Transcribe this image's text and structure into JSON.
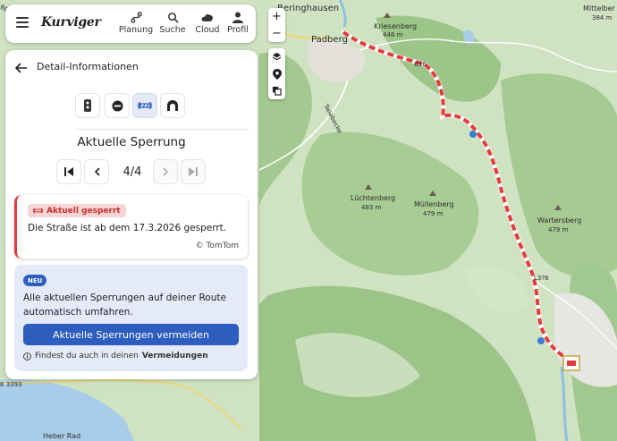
{
  "app": {
    "logo_text": "Kurviger"
  },
  "nav": {
    "items": [
      {
        "label": "Planung",
        "icon": "route-planning-icon"
      },
      {
        "label": "Suche",
        "icon": "search-icon"
      },
      {
        "label": "Cloud",
        "icon": "cloud-icon"
      },
      {
        "label": "Profil",
        "icon": "user-icon"
      }
    ]
  },
  "panel": {
    "title": "Detail-Informationen",
    "section_title": "Aktuelle Sperrung",
    "pager": {
      "current": 4,
      "total": 4,
      "text": "4/4"
    },
    "closure": {
      "badge": "Aktuell gesperrt",
      "text": "Die Straße ist ab dem 17.3.2026 gesperrt.",
      "attribution": "© TomTom"
    },
    "info": {
      "badge": "NEU",
      "text": "Alle aktuellen Sperrungen auf deiner Route automatisch umfahren.",
      "button": "Aktuelle Sperrungen vermeiden",
      "hint_prefix": "Findest du auch in deinen",
      "hint_bold": "Vermeidungen"
    }
  },
  "map": {
    "zoom_in": "+",
    "zoom_out": "−",
    "labels": {
      "beringhausen": "Beringhausen",
      "padberg": "Padberg",
      "kriesenberg": "Kriesenberg",
      "kriesenberg_elev": "446 m",
      "mittelberg": "Mittelber",
      "mittelberg_elev": "384 m",
      "luechtenberg": "Lüchtenberg",
      "luechtenberg_elev": "483 m",
      "muellenberg": "Müllenberg",
      "muellenberg_elev": "479 m",
      "wartersberg": "Wartersberg",
      "wartersberg_elev": "479 m",
      "twiebecke": "Twiebecke",
      "road_b": "B36",
      "road_l": "L3?6",
      "road_k": "K 3393",
      "heber": "Heber Rad",
      "bpre": "Bpres"
    },
    "colors": {
      "route": "#e23b3b",
      "water": "#a9cde8",
      "forest": "#9fc78c",
      "meadow": "#cfe3c2"
    }
  }
}
